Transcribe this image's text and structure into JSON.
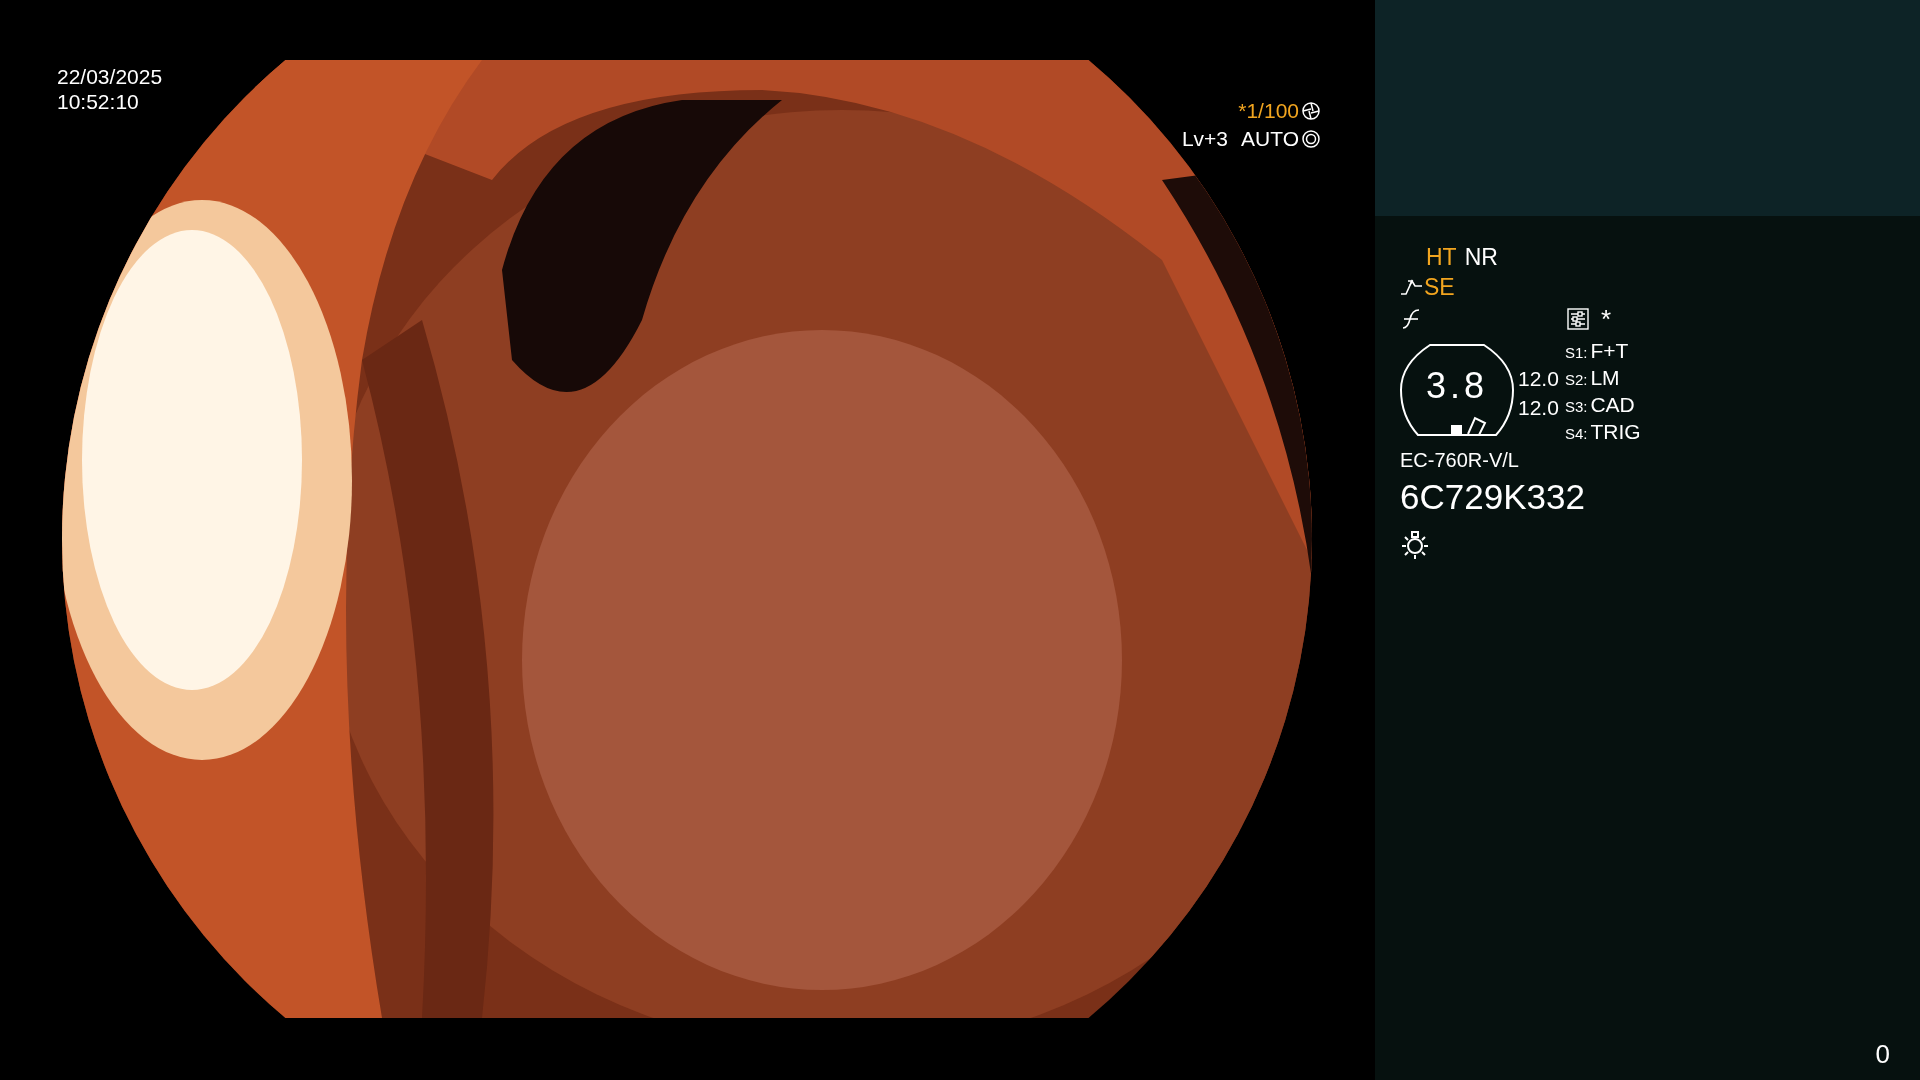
{
  "datetime": {
    "date": "22/03/2025",
    "time": "10:52:10"
  },
  "exposure": {
    "shutter": "*1/100",
    "shutter_active": true,
    "brightness": "Lv+3",
    "mode": "AUTO"
  },
  "image_modes": [
    {
      "label": "HT",
      "active": true
    },
    {
      "label": "NR",
      "active": false
    }
  ],
  "enhancement": {
    "label": "SE",
    "active": true
  },
  "marker": "*",
  "zoom_gauge": {
    "value": "3.8"
  },
  "readings": [
    "12.0",
    "12.0"
  ],
  "switches": [
    {
      "switch": "S1:",
      "function": "F+T"
    },
    {
      "switch": "S2:",
      "function": "LM"
    },
    {
      "switch": "S3:",
      "function": "CAD"
    },
    {
      "switch": "S4:",
      "function": "TRIG"
    }
  ],
  "scope": {
    "model": "EC-760R-V/L",
    "serial": "6C729K332"
  },
  "counter": "0"
}
